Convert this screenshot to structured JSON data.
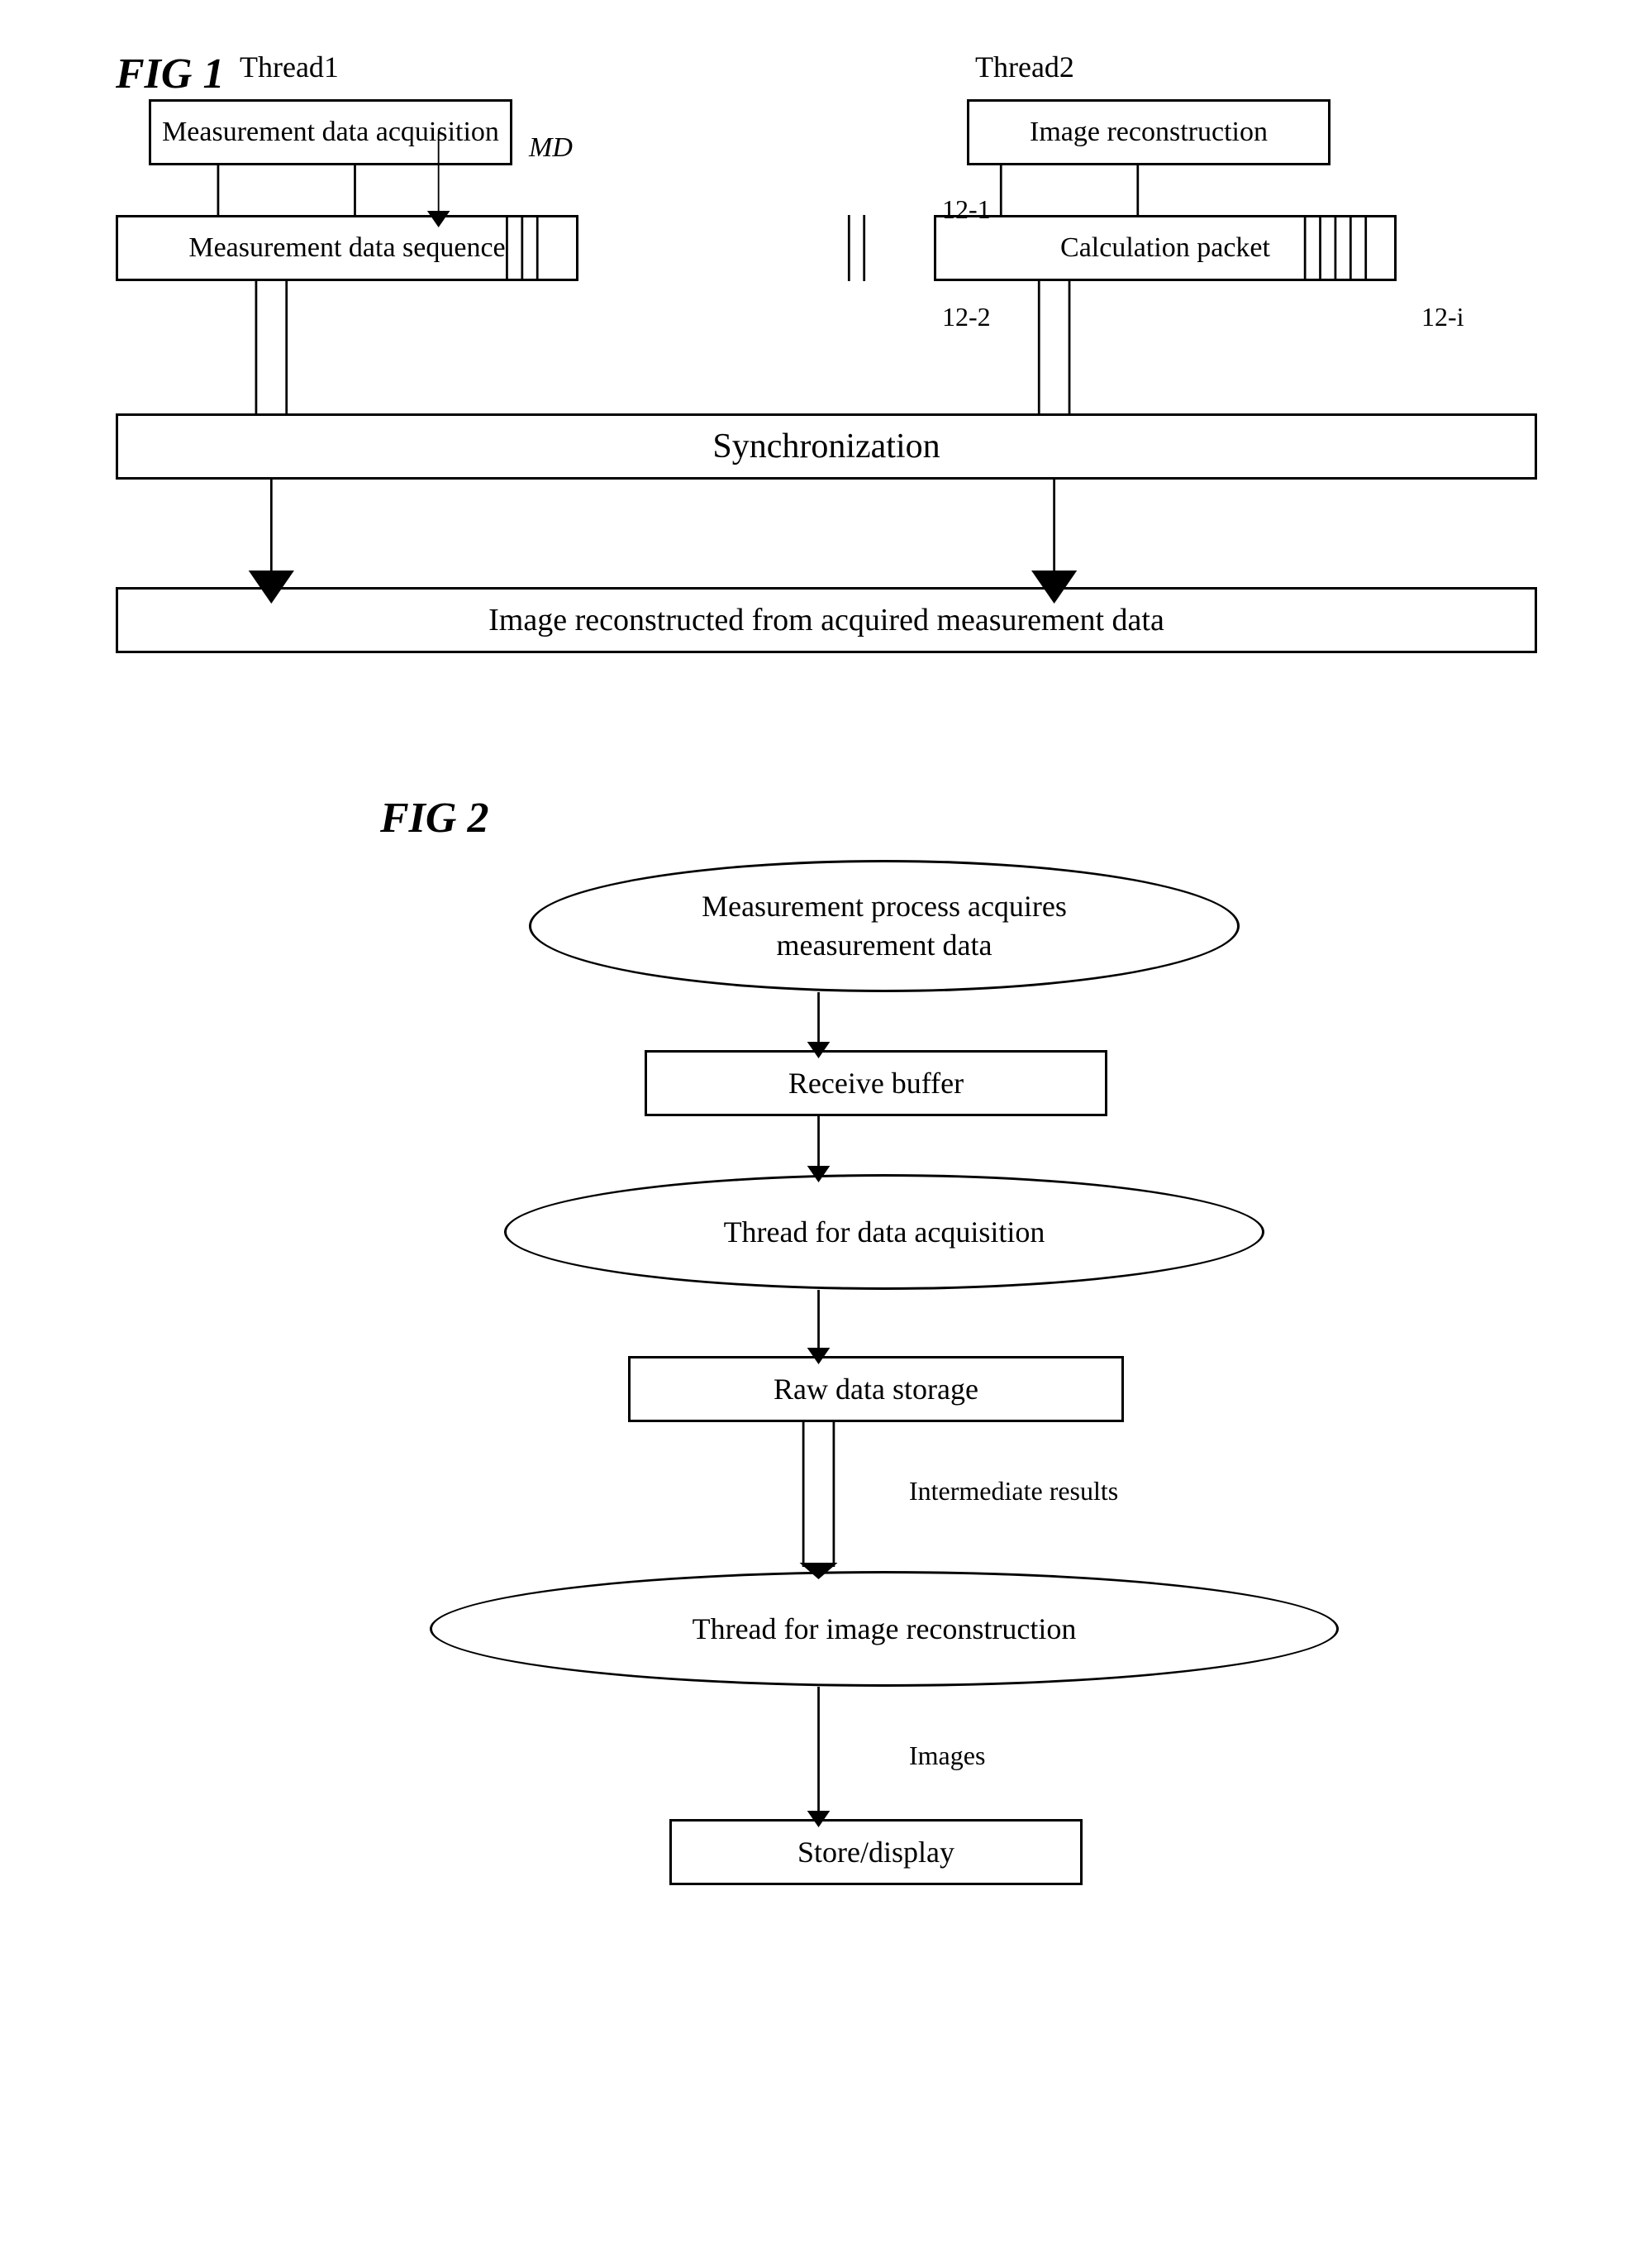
{
  "fig1": {
    "label": "FIG 1",
    "thread1_label": "Thread1",
    "thread2_label": "Thread2",
    "md_label": "MD",
    "mda_box": "Measurement data acquisition",
    "ir_box": "Image reconstruction",
    "mds_box": "Measurement data sequence",
    "cp_box": "Calculation packet",
    "sync_box": "Synchronization",
    "imr_box": "Image reconstructed from acquired measurement data",
    "ref1": "12-1",
    "ref2": "12-2",
    "refi": "12-i"
  },
  "fig2": {
    "label": "FIG 2",
    "ellipse1": "Measurement process acquires\nmeasurement data",
    "rect1": "Receive buffer",
    "ellipse2": "Thread for data acquisition",
    "rect2": "Raw data storage",
    "label_intermediate": "Intermediate results",
    "ellipse3": "Thread for image reconstruction",
    "label_images": "Images",
    "rect3": "Store/display"
  }
}
